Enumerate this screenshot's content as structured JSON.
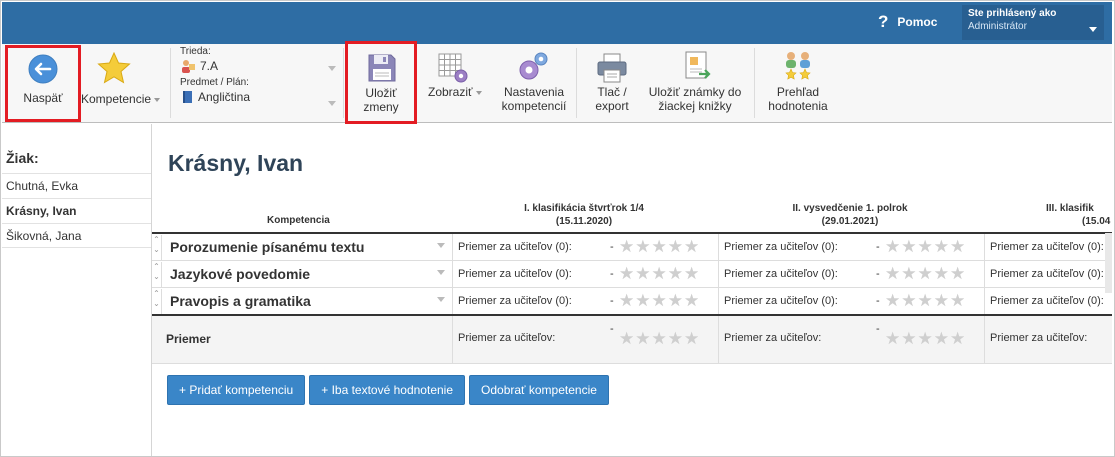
{
  "header": {
    "help_icon": "?",
    "help_label": "Pomoc",
    "user_caption": "Ste prihlásený ako",
    "user_name": "Administrátor"
  },
  "toolbar": {
    "back_label": "Naspäť",
    "competences_label": "Kompetencie",
    "class_caption": "Trieda:",
    "class_value": "7.A",
    "subject_caption": "Predmet / Plán:",
    "subject_value": "Angličtina",
    "save_label_1": "Uložiť",
    "save_label_2": "zmeny",
    "view_label": "Zobraziť",
    "settings_label_1": "Nastavenia",
    "settings_label_2": "kompetencií",
    "print_label_1": "Tlač /",
    "print_label_2": "export",
    "export_grades_label_1": "Uložiť známky do",
    "export_grades_label_2": "žiackej knižky",
    "overview_label_1": "Prehľad",
    "overview_label_2": "hodnotenia"
  },
  "sidebar": {
    "title": "Žiak:",
    "students": [
      "Chutná, Evka",
      "Krásny, Ivan",
      "Šikovná, Jana"
    ],
    "active_index": 1
  },
  "main": {
    "student_name": "Krásny, Ivan",
    "competence_header": "Kompetencia",
    "periods": [
      {
        "title": "I. klasifikácia štvrťrok 1/4",
        "date": "(15.11.2020)"
      },
      {
        "title": "II. vysvedčenie 1. polrok",
        "date": "(29.01.2021)"
      },
      {
        "title": "III. klasifik",
        "date": "(15.04"
      }
    ],
    "competences": [
      "Porozumenie písanému textu",
      "Jazykové povedomie",
      "Pravopis a gramatika"
    ],
    "cell_label": "Priemer za učiteľov (0):",
    "cell_dash": "-",
    "average_row_label": "Priemer",
    "average_cell_label": "Priemer za učiteľov:",
    "stars": "★★★★★"
  },
  "actions": {
    "add_competence": "+ Pridať kompetenciu",
    "text_only": "+ Iba textové hodnotenie",
    "remove_competence": "Odobrať kompetencie"
  },
  "colors": {
    "header_bg": "#2e6da4",
    "highlight_red": "#e31c23",
    "button_blue": "#3a86c8"
  }
}
